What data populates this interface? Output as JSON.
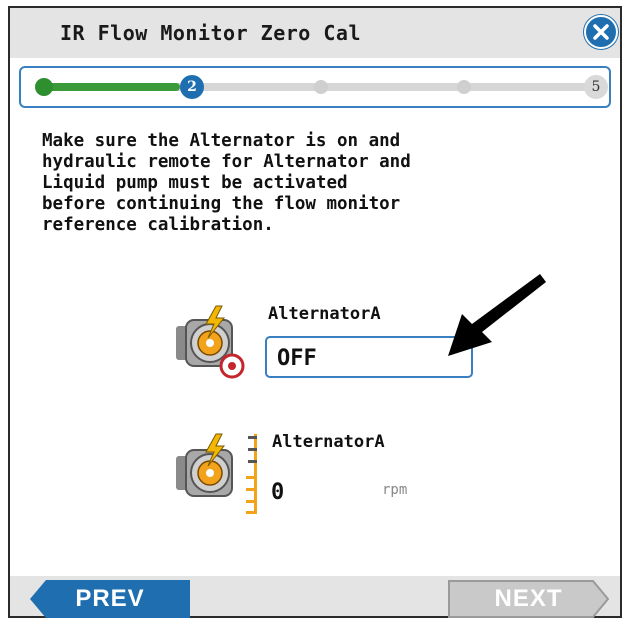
{
  "dialog": {
    "title": "IR Flow Monitor Zero Cal",
    "close_icon": "close-icon"
  },
  "progress": {
    "current_step": "2",
    "total_steps": "5",
    "fraction_complete": 0.25
  },
  "instructions": "Make sure the Alternator is on and\nhydraulic remote for Alternator and\nLiquid pump must be activated\nbefore continuing the flow monitor\nreference calibration.",
  "alternator_status": {
    "label": "AlternatorA",
    "value": "OFF",
    "icon": "alternator-power-icon"
  },
  "alternator_speed": {
    "label": "AlternatorA",
    "value": "0",
    "unit": "rpm",
    "icon": "alternator-speed-icon"
  },
  "annotation": {
    "icon": "pointer-arrow-icon"
  },
  "footer": {
    "prev_label": "PREV",
    "next_label": "NEXT"
  },
  "colors": {
    "accent_blue": "#1f6fb0",
    "progress_green": "#3a9a3a",
    "bar_gray": "#e4e4e4",
    "icon_orange": "#f2a31b"
  }
}
